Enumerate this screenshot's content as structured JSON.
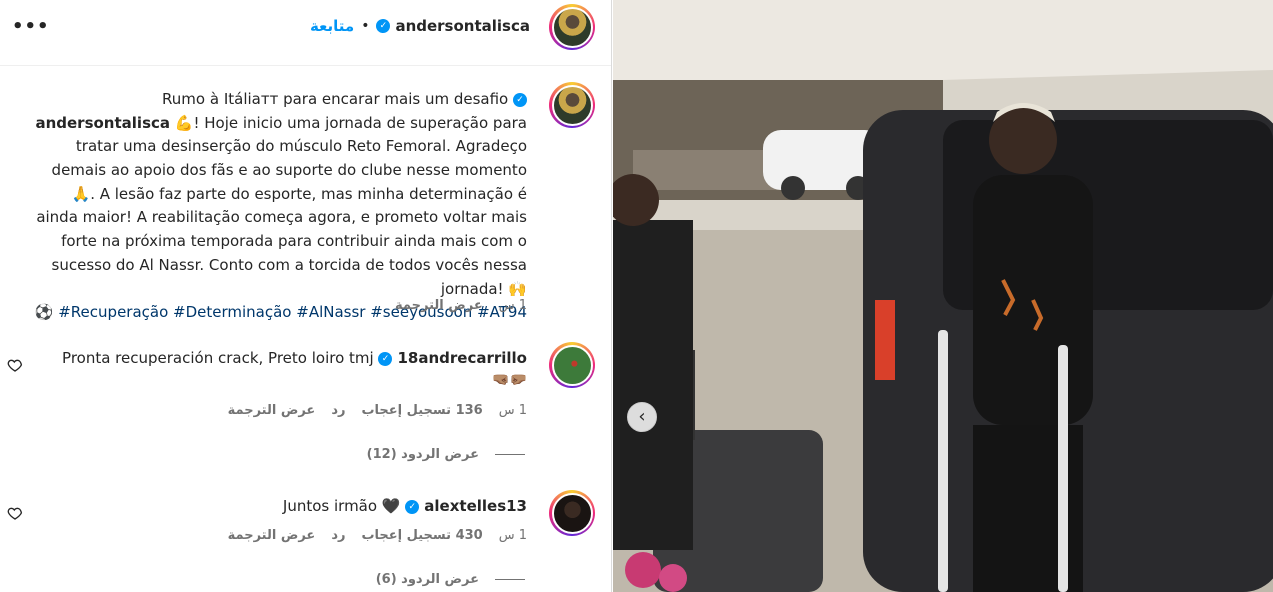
{
  "header": {
    "username": "andersontalisca",
    "follow_label": "متابعة",
    "separator": "•",
    "more_label": "•••"
  },
  "caption": {
    "username": "andersontalisca",
    "text": "Rumo à Itáliaᴛᴛ para encarar mais um desafio",
    "body": "💪! Hoje inicio uma jornada de superação para tratar uma desinserção do músculo Reto Femoral. Agradeço demais ao apoio dos fãs e ao suporte do clube nesse momento 🙏. A lesão faz parte do esporte, mas minha determinação é ainda maior! A reabilitação começa agora, e prometo voltar mais forte na próxima temporada para contribuir ainda mais com o sucesso do Al Nassr. Conto com a torcida de todos vocês nessa jornada! 🙌",
    "hashtags": "⚽ #Recuperação #Determinação #AlNassr #seeyousoon #AT94",
    "time": "1 س",
    "translate_label": "عرض الترجمة"
  },
  "comments": [
    {
      "username": "18andrecarrillo",
      "text": "Pronta recuperación crack, Preto loiro tmj",
      "emoji": "🤜🏽🤛🏽",
      "time": "1 س",
      "likes": "136 تسجيل إعجاب",
      "reply_label": "رد",
      "translate_label": "عرض الترجمة",
      "view_replies": "عرض الردود (12)"
    },
    {
      "username": "alextelles13",
      "text": "Juntos irmão 🖤",
      "time": "1 س",
      "likes": "430 تسجيل إعجاب",
      "reply_label": "رد",
      "translate_label": "عرض الترجمة",
      "view_replies": "عرض الردود (6)"
    }
  ],
  "icons": {
    "verified": "verified-badge-icon",
    "heart": "heart-outline-icon",
    "prev": "chevron-left-icon"
  },
  "colors": {
    "link_blue": "#0095f6",
    "hashtag": "#00376b",
    "muted": "#737373"
  }
}
